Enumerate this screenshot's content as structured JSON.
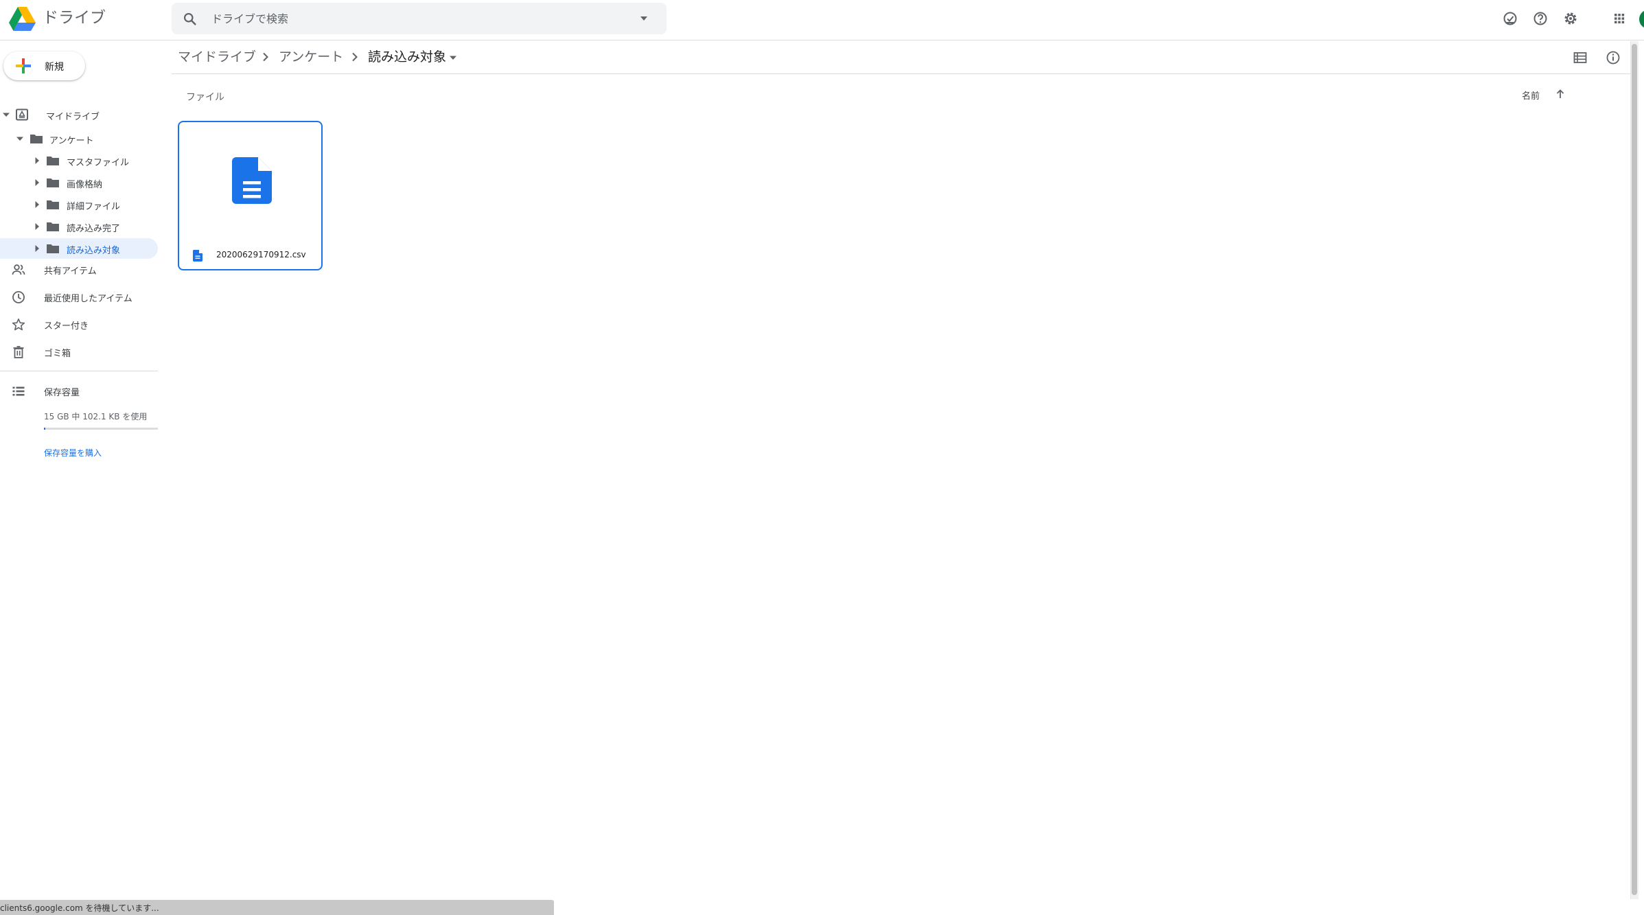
{
  "header": {
    "app_name": "ドライブ",
    "search_placeholder": "ドライブで検索"
  },
  "sidebar": {
    "new_label": "新規",
    "tree": [
      {
        "label": "マイドライブ"
      },
      {
        "label": "アンケート"
      },
      {
        "label": "マスタファイル"
      },
      {
        "label": "画像格納"
      },
      {
        "label": "詳細ファイル"
      },
      {
        "label": "読み込み完了"
      },
      {
        "label": "読み込み対象"
      }
    ],
    "nav": [
      {
        "label": "共有アイテム",
        "icon": "people-icon"
      },
      {
        "label": "最近使用したアイテム",
        "icon": "clock-icon"
      },
      {
        "label": "スター付き",
        "icon": "star-icon"
      },
      {
        "label": "ゴミ箱",
        "icon": "trash-icon"
      }
    ],
    "storage": {
      "label": "保存容量",
      "usage_text": "15 GB 中 102.1 KB を使用",
      "used_fraction": 0.01,
      "buy_label": "保存容量を購入"
    }
  },
  "main": {
    "breadcrumb": [
      "マイドライブ",
      "アンケート",
      "読み込み対象"
    ],
    "section_label": "ファイル",
    "sort_label": "名前",
    "files": [
      {
        "name": "20200629170912.csv"
      }
    ]
  },
  "status_bar": {
    "text": "clients6.google.com を待機しています..."
  },
  "colors": {
    "accent": "#1a73e8",
    "active_bg": "#e8f0fe",
    "folder": "#5f6368"
  }
}
